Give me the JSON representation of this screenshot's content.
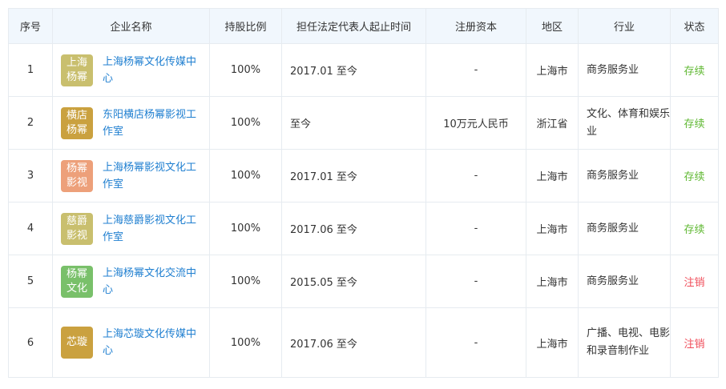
{
  "table": {
    "headers": {
      "index": "序号",
      "company": "企业名称",
      "share": "持股比例",
      "period": "担任法定代表人起止时间",
      "capital": "注册资本",
      "region": "地区",
      "industry": "行业",
      "status": "状态"
    },
    "rows": [
      {
        "index": "1",
        "logo_text": "上海杨幂",
        "logo_color": "#c9bf6e",
        "name": "上海杨幂文化传媒中心",
        "share": "100%",
        "period": "2017.01 至今",
        "capital": "-",
        "region": "上海市",
        "industry": "商务服务业",
        "status": "存续",
        "status_color": "#5fb832"
      },
      {
        "index": "2",
        "logo_text": "横店杨幂",
        "logo_color": "#caa13f",
        "name": "东阳横店杨幂影视工作室",
        "share": "100%",
        "period": "至今",
        "capital": "10万元人民币",
        "region": "浙江省",
        "industry": "文化、体育和娱乐业",
        "status": "存续",
        "status_color": "#5fb832"
      },
      {
        "index": "3",
        "logo_text": "杨幂影视",
        "logo_color": "#eda07a",
        "name": "上海杨幂影视文化工作室",
        "share": "100%",
        "period": "2017.01 至今",
        "capital": "-",
        "region": "上海市",
        "industry": "商务服务业",
        "status": "存续",
        "status_color": "#5fb832"
      },
      {
        "index": "4",
        "logo_text": "慈爵影视",
        "logo_color": "#c9bf6e",
        "name": "上海慈爵影视文化工作室",
        "share": "100%",
        "period": "2017.06 至今",
        "capital": "-",
        "region": "上海市",
        "industry": "商务服务业",
        "status": "存续",
        "status_color": "#5fb832"
      },
      {
        "index": "5",
        "logo_text": "杨幂文化",
        "logo_color": "#79c06a",
        "name": "上海杨幂文化交流中心",
        "share": "100%",
        "period": "2015.05 至今",
        "capital": "-",
        "region": "上海市",
        "industry": "商务服务业",
        "status": "注销",
        "status_color": "#f04d5a"
      },
      {
        "index": "6",
        "logo_text": "芯璇",
        "logo_color": "#caa13f",
        "name": "上海芯璇文化传媒中心",
        "share": "100%",
        "period": "2017.06 至今",
        "capital": "-",
        "region": "上海市",
        "industry": "广播、电视、电影和录音制作业",
        "status": "注销",
        "status_color": "#f04d5a"
      }
    ]
  }
}
